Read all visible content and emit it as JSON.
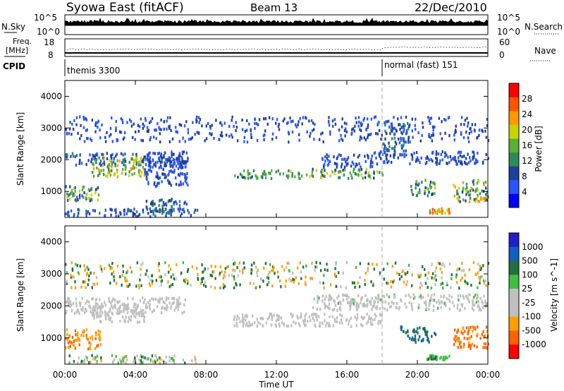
{
  "header": {
    "title": "Syowa East (fitACF)",
    "beam": "Beam 13",
    "date": "22/Dec/2010"
  },
  "top_panels": {
    "sky_label": "N.Sky",
    "sky_ticks": [
      "10^5",
      "10^0"
    ],
    "search_label": "N.Search",
    "search_ticks": [
      "10^5",
      "10^0"
    ],
    "freq_label": "Freq.",
    "freq_unit": "[MHz]",
    "freq_ticks": [
      "18",
      "8"
    ],
    "nave_label": "Nave",
    "nave_ticks": [
      "60",
      "0"
    ],
    "cpid_label": "CPID",
    "cpid_segments": [
      {
        "label": "themis 3300",
        "start_hour": 0
      },
      {
        "label": "normal (fast) 151",
        "start_hour": 18
      }
    ]
  },
  "colors": {
    "power_scale": [
      "#0000ff",
      "#2a55ff",
      "#1f3f9a",
      "#2e8b57",
      "#5aaf3a",
      "#c8d400",
      "#ff9900",
      "#ff5500",
      "#ff0000"
    ],
    "velocity_scale": [
      "#2020c8",
      "#1060c0",
      "#207040",
      "#40c040",
      "#c0c0c0",
      "#c0c0c0",
      "#ffa000",
      "#ff6000",
      "#ff0000"
    ]
  },
  "chart_data": [
    {
      "type": "heatmap",
      "title": "Power",
      "xlabel": "",
      "ylabel": "Slant Range [km]",
      "xlim": [
        0,
        24
      ],
      "ylim": [
        180,
        4500
      ],
      "x_tick_labels": [
        "00:00",
        "04:00",
        "08:00",
        "12:00",
        "16:00",
        "20:00",
        "00:00"
      ],
      "y_ticks": [
        1000,
        2000,
        3000,
        4000
      ],
      "colorbar": {
        "label": "Power [dB]",
        "range": [
          0,
          32
        ],
        "ticks": [
          4,
          8,
          12,
          16,
          20,
          24,
          28
        ]
      },
      "regions": [
        {
          "t": [
            0.0,
            6.8
          ],
          "r": [
            1850,
            2250
          ],
          "v": [
            4,
            12
          ]
        },
        {
          "t": [
            1.5,
            4.5
          ],
          "r": [
            1500,
            2100
          ],
          "v": [
            10,
            24
          ]
        },
        {
          "t": [
            0.0,
            2.0
          ],
          "r": [
            700,
            1200
          ],
          "v": [
            6,
            22
          ]
        },
        {
          "t": [
            4.5,
            7.0
          ],
          "r": [
            1200,
            2300
          ],
          "v": [
            4,
            9
          ]
        },
        {
          "t": [
            9.5,
            14.0
          ],
          "r": [
            1450,
            1700
          ],
          "v": [
            10,
            18
          ]
        },
        {
          "t": [
            14.0,
            18.0
          ],
          "r": [
            1450,
            1750
          ],
          "v": [
            8,
            20
          ]
        },
        {
          "t": [
            14.5,
            17.5
          ],
          "r": [
            1800,
            2200
          ],
          "v": [
            4,
            10
          ]
        },
        {
          "t": [
            17.5,
            24.0
          ],
          "r": [
            1900,
            2300
          ],
          "v": [
            4,
            10
          ]
        },
        {
          "t": [
            18.0,
            19.5
          ],
          "r": [
            2300,
            3200
          ],
          "v": [
            6,
            14
          ]
        },
        {
          "t": [
            19.5,
            21.0
          ],
          "r": [
            900,
            1400
          ],
          "v": [
            8,
            18
          ]
        },
        {
          "t": [
            22.0,
            24.0
          ],
          "r": [
            700,
            1400
          ],
          "v": [
            8,
            24
          ]
        },
        {
          "t": [
            20.5,
            21.8
          ],
          "r": [
            350,
            500
          ],
          "v": [
            16,
            28
          ]
        },
        {
          "t": [
            0.0,
            7.5
          ],
          "r": [
            250,
            500
          ],
          "v": [
            4,
            12
          ]
        },
        {
          "t": [
            4.5,
            7.0
          ],
          "r": [
            400,
            800
          ],
          "v": [
            6,
            14
          ]
        },
        {
          "t": [
            0.0,
            24.0
          ],
          "r": [
            2600,
            3400
          ],
          "v": [
            4,
            10
          ]
        }
      ]
    },
    {
      "type": "heatmap",
      "title": "Velocity",
      "xlabel": "Time UT",
      "ylabel": "Slant Range [km]",
      "xlim": [
        0,
        24
      ],
      "ylim": [
        180,
        4500
      ],
      "x_tick_labels": [
        "00:00",
        "04:00",
        "08:00",
        "12:00",
        "16:00",
        "20:00",
        "00:00"
      ],
      "y_ticks": [
        1000,
        2000,
        3000,
        4000
      ],
      "colorbar": {
        "label": "Velocity [m s^-1]",
        "ticks": [
          1000,
          500,
          100,
          25,
          -25,
          -100,
          -500,
          -1000
        ]
      },
      "regions": [
        {
          "t": [
            0.0,
            6.8
          ],
          "r": [
            1800,
            2300
          ],
          "v": [
            -20,
            20
          ]
        },
        {
          "t": [
            1.5,
            4.5
          ],
          "r": [
            1500,
            2100
          ],
          "v": [
            -25,
            25
          ]
        },
        {
          "t": [
            0.0,
            2.0
          ],
          "r": [
            700,
            1300
          ],
          "v": [
            -700,
            -100
          ]
        },
        {
          "t": [
            9.5,
            18.0
          ],
          "r": [
            1400,
            1800
          ],
          "v": [
            -20,
            20
          ]
        },
        {
          "t": [
            14.0,
            24.0
          ],
          "r": [
            1900,
            2400
          ],
          "v": [
            -30,
            30
          ]
        },
        {
          "t": [
            19.0,
            21.0
          ],
          "r": [
            900,
            1400
          ],
          "v": [
            100,
            900
          ]
        },
        {
          "t": [
            22.0,
            24.0
          ],
          "r": [
            700,
            1400
          ],
          "v": [
            -1000,
            -300
          ]
        },
        {
          "t": [
            20.5,
            21.8
          ],
          "r": [
            350,
            500
          ],
          "v": [
            60,
            120
          ]
        },
        {
          "t": [
            0.0,
            7.5
          ],
          "r": [
            250,
            500
          ],
          "v": [
            -150,
            150
          ]
        },
        {
          "t": [
            0.0,
            24.0
          ],
          "r": [
            2600,
            3400
          ],
          "v": [
            -300,
            300
          ]
        }
      ]
    }
  ]
}
